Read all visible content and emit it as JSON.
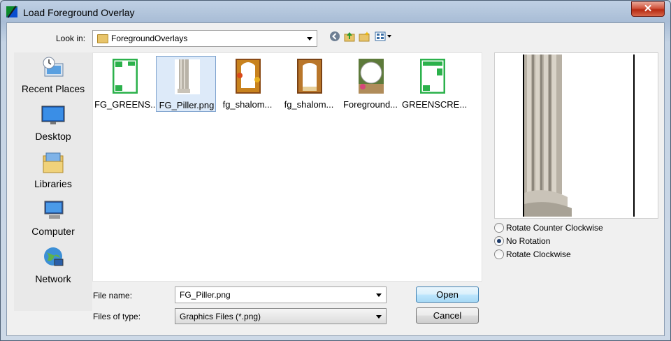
{
  "window": {
    "title": "Load Foreground Overlay",
    "close_label": "✕"
  },
  "lookin": {
    "label": "Look in:",
    "value": "ForegroundOverlays"
  },
  "toolbar": {
    "icons": [
      "back-icon",
      "up-folder-icon",
      "new-folder-icon",
      "view-menu-icon"
    ]
  },
  "places": [
    {
      "label": "Recent Places",
      "icon": "recent-places-icon"
    },
    {
      "label": "Desktop",
      "icon": "desktop-icon"
    },
    {
      "label": "Libraries",
      "icon": "libraries-icon"
    },
    {
      "label": "Computer",
      "icon": "computer-icon"
    },
    {
      "label": "Network",
      "icon": "network-icon"
    }
  ],
  "files": [
    {
      "name": "FG_GREENS...",
      "selected": false
    },
    {
      "name": "FG_Piller.png",
      "selected": true
    },
    {
      "name": "fg_shalom...",
      "selected": false
    },
    {
      "name": "fg_shalom...",
      "selected": false
    },
    {
      "name": "Foreground...",
      "selected": false
    },
    {
      "name": "GREENSCRE...",
      "selected": false
    }
  ],
  "rotation": {
    "options": [
      "Rotate Counter Clockwise",
      "No Rotation",
      "Rotate Clockwise"
    ],
    "selected_index": 1
  },
  "filename": {
    "label": "File name:",
    "value": "FG_Piller.png"
  },
  "filetype": {
    "label": "Files of type:",
    "value": "Graphics Files (*.png)"
  },
  "buttons": {
    "open": "Open",
    "cancel": "Cancel"
  }
}
